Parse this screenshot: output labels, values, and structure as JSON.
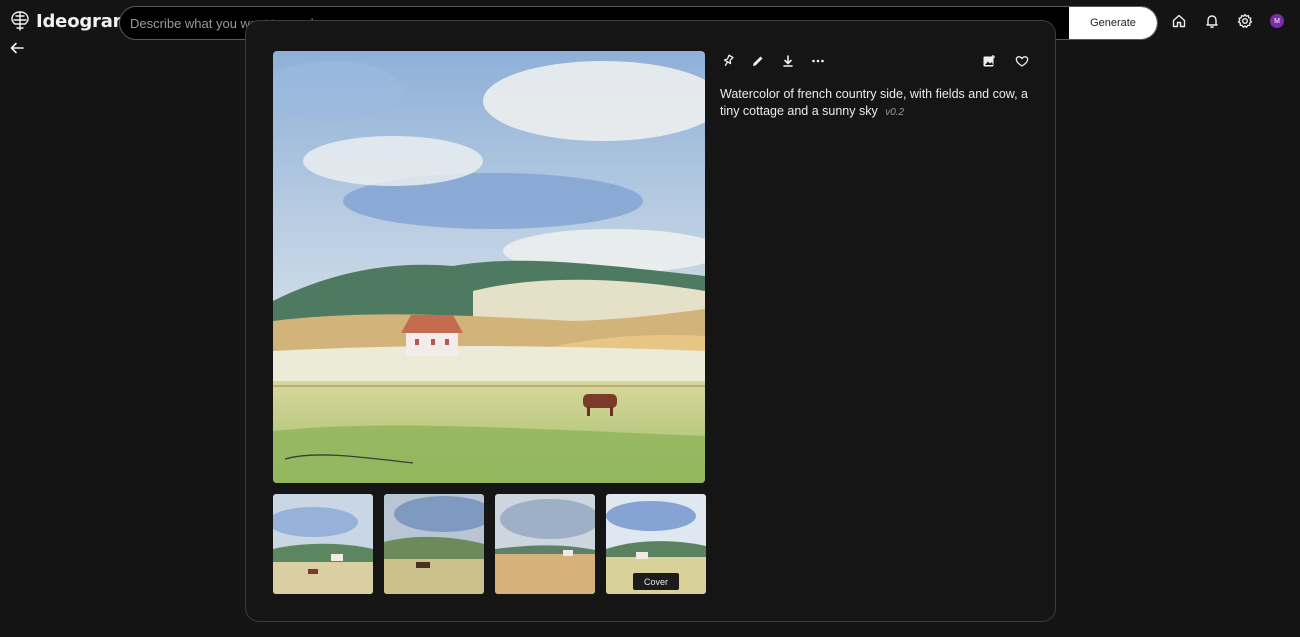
{
  "app": {
    "name": "Ideogram"
  },
  "search": {
    "placeholder": "Describe what you want to see here.",
    "generate_label": "Generate"
  },
  "header_icons": [
    "home-icon",
    "bell-icon",
    "gear-icon"
  ],
  "user": {
    "avatar_initial": "M",
    "avatar_color": "#7b2ca8"
  },
  "image": {
    "prompt": "Watercolor of french country side, with fields and cow, a tiny cottage and a sunny sky",
    "version": "v0.2"
  },
  "actions": [
    "pin-icon",
    "edit-icon",
    "download-icon",
    "more-icon"
  ],
  "secondary_actions": [
    "add-image-icon",
    "heart-icon"
  ],
  "thumbnails": [
    {
      "name": "thumbnail-1",
      "selected": false
    },
    {
      "name": "thumbnail-2",
      "selected": false
    },
    {
      "name": "thumbnail-3",
      "selected": false
    },
    {
      "name": "thumbnail-4",
      "selected": true,
      "badge": "Cover"
    }
  ]
}
